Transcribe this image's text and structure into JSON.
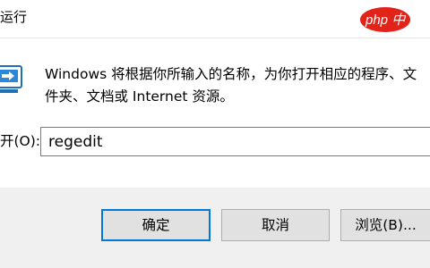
{
  "window": {
    "title": "运行",
    "watermark": "php 中"
  },
  "dialog": {
    "description_line1": "Windows 将根据你所输入的名称，为你打开相应的程序、文",
    "description_line2": "件夹、文档或 Internet 资源。",
    "open_label": "开(O):",
    "open_value": "regedit"
  },
  "buttons": {
    "ok": "确定",
    "cancel": "取消",
    "browse": "浏览(B)..."
  },
  "colors": {
    "accent": "#0078d7",
    "footer_bg": "#f0f0f0",
    "button_bg": "#e1e1e1",
    "watermark_red": "#e2231a"
  }
}
